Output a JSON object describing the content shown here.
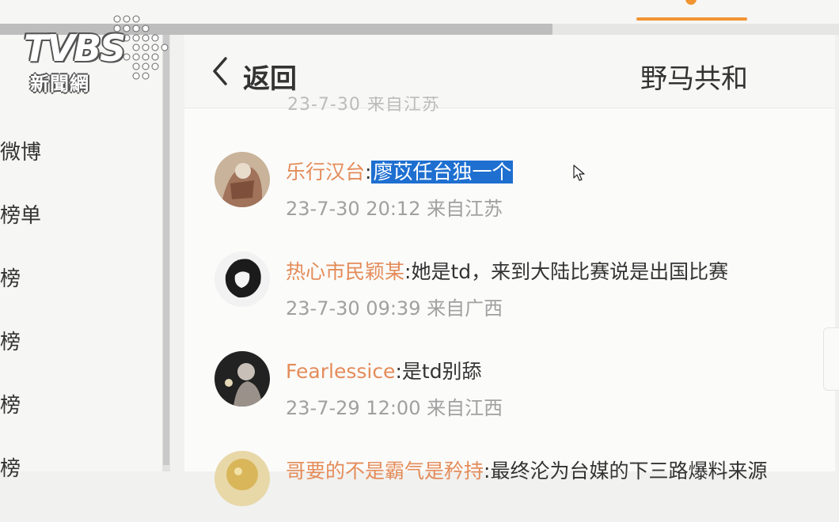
{
  "logo": {
    "brand": "TVBS",
    "subtitle": "新聞網"
  },
  "sidebar": {
    "items": [
      {
        "label": "微博"
      },
      {
        "label": "榜单"
      },
      {
        "label": "榜"
      },
      {
        "label": "榜"
      },
      {
        "label": "榜"
      },
      {
        "label": "榜"
      }
    ]
  },
  "header": {
    "back_label": "返回",
    "title": "野马共和"
  },
  "truncated_meta": "23-7-30 来自江苏",
  "comments": [
    {
      "user": "乐行汉台",
      "sep": ":",
      "text": "廖苡任台独一个",
      "selected": true,
      "time": "23-7-30 20:12",
      "source": "来自江苏"
    },
    {
      "user": "热心市民颖某",
      "sep": ":",
      "text": "她是td，来到大陆比赛说是出国比赛",
      "selected": false,
      "time": "23-7-30 09:39",
      "source": "来自广西"
    },
    {
      "user": "Fearlessice",
      "sep": ":",
      "text": "是td别舔",
      "selected": false,
      "time": "23-7-29 12:00",
      "source": "来自江西"
    },
    {
      "user": "哥要的不是霸气是矜持",
      "sep": ":",
      "text": "最终沦为台媒的下三路爆料来源",
      "selected": false,
      "time": "",
      "source": ""
    }
  ],
  "colors": {
    "accent": "#f29432",
    "username": "#e48c5a",
    "selection": "#1e6fd0",
    "meta": "#a0a0a0"
  },
  "icons": {
    "back": "chevron-left-icon",
    "cursor": "mouse-pointer-icon"
  }
}
